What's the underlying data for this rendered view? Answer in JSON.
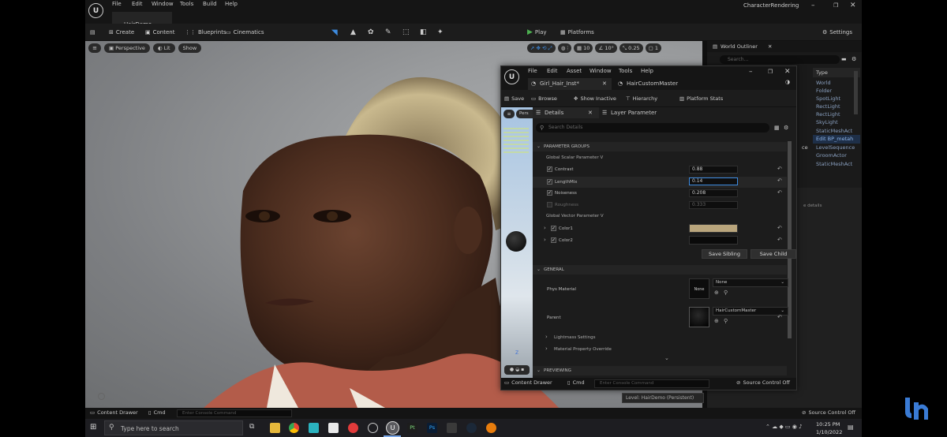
{
  "menubar": {
    "items": [
      "File",
      "Edit",
      "Window",
      "Tools",
      "Build",
      "Help"
    ],
    "level_tab": "HairDemo",
    "project": "CharacterRendering"
  },
  "toolbar": {
    "create": "Create",
    "content": "Content",
    "blueprints": "Blueprints",
    "cinematics": "Cinematics",
    "play": "Play",
    "platforms": "Platforms",
    "settings": "Settings"
  },
  "viewport": {
    "perspective": "Perspective",
    "lit": "Lit",
    "show": "Show",
    "grid_snap": "10",
    "rot_snap": "10°",
    "scale_snap": "0.25",
    "cam_speed": "1"
  },
  "outliner": {
    "title": "World Outliner",
    "search_placeholder": "Search...",
    "type_header": "Type",
    "types": [
      "World",
      "Folder",
      "SpotLight",
      "RectLight",
      "RectLight",
      "SkyLight",
      "StaticMeshAct",
      "Edit BP_metah",
      "LevelSequence",
      "GroomActor",
      "StaticMeshAct"
    ],
    "partial_ce": "ce",
    "partial_details": "e details"
  },
  "material": {
    "menu": [
      "File",
      "Edit",
      "Asset",
      "Window",
      "Tools",
      "Help"
    ],
    "tab1": "Girl_Hair_Inst*",
    "tab2": "HairCustomMaster",
    "save": "Save",
    "browse": "Browse",
    "show_inactive": "Show Inactive",
    "hierarchy": "Hierarchy",
    "platform_stats": "Platform Stats",
    "details_tab": "Details",
    "layer_tab": "Layer Parameter",
    "search_placeholder": "Search Details",
    "preview_tab": "Pers",
    "section_param_groups": "PARAMETER GROUPS",
    "global_scalar": "Global Scalar Parameter V",
    "contrast_label": "Contrast",
    "contrast_value": "0.88",
    "lengthmix_label": "LengthMix",
    "lengthmix_value": "0.14",
    "noiseness_label": "Noiseness",
    "noiseness_value": "0.208",
    "roughness_label": "Roughness",
    "roughness_value": "0.333",
    "global_vector": "Global Vector Parameter V",
    "color1_label": "Color1",
    "color1_value": "#b9a57c",
    "color2_label": "Color2",
    "color2_value": "#0a0a0a",
    "save_sibling": "Save Sibling",
    "save_child": "Save Child",
    "section_general": "GENERAL",
    "phys_label": "Phys Material",
    "phys_thumb": "None",
    "phys_value": "None",
    "parent_label": "Parent",
    "parent_value": "HairCustomMaster",
    "lightmass": "Lightmass Settings",
    "mat_override": "Material Property Override",
    "section_previewing": "PREVIEWING",
    "content_drawer": "Content Drawer",
    "cmd": "Cmd",
    "console_placeholder": "Enter Console Command",
    "source_control": "Source Control Off",
    "level_tooltip": "Level: HairDemo (Persistent)"
  },
  "statusbar": {
    "content_drawer": "Content Drawer",
    "cmd": "Cmd",
    "console_placeholder": "Enter Console Command",
    "source_control": "Source Control Off"
  },
  "taskbar": {
    "search_placeholder": "Type here to search",
    "time": "10:25 PM",
    "date": "1/10/2022",
    "app_pt": "Pt",
    "app_ps": "Ps"
  }
}
